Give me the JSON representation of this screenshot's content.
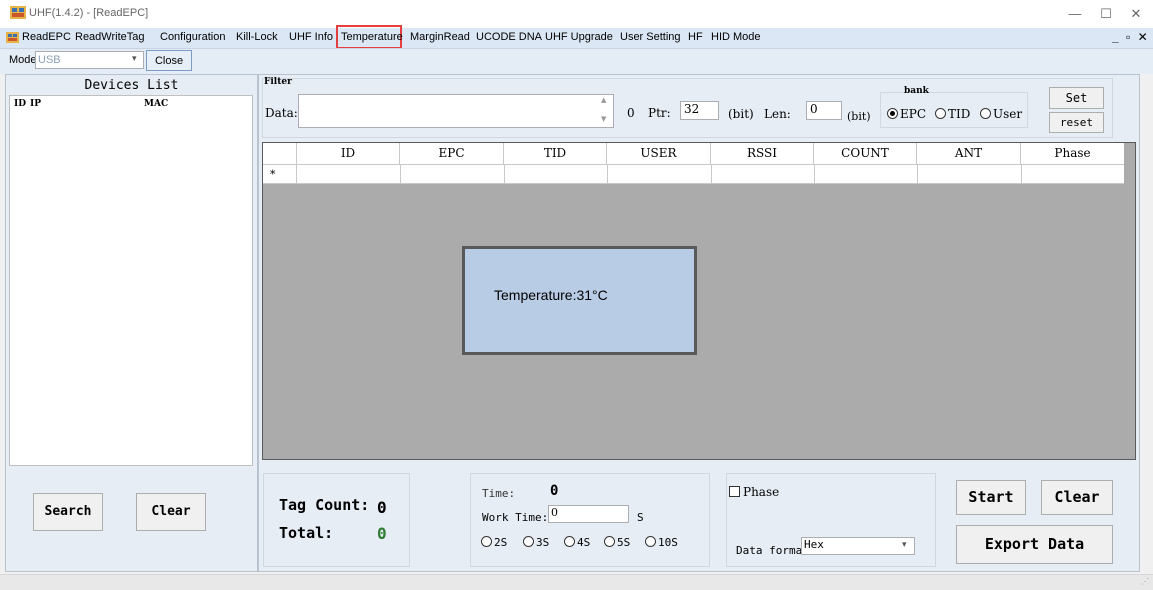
{
  "window": {
    "title": "UHF(1.4.2) - [ReadEPC]",
    "min_glyph": "—",
    "max_glyph": "☐",
    "close_glyph": "✕",
    "mdi_controls": "_ ▫ ✕"
  },
  "menu": [
    "ReadEPC",
    "ReadWriteTag",
    "Configuration",
    "Kill-Lock",
    "UHF Info",
    "Temperature",
    "MarginRead",
    "UCODE DNA",
    "UHF Upgrade",
    "User Setting",
    "HF",
    "HID Mode"
  ],
  "toolbar": {
    "mode_label": "Mode",
    "mode_value": "USB",
    "close_label": "Close"
  },
  "devices": {
    "title": "Devices List",
    "columns": [
      "ID",
      "IP",
      "MAC"
    ],
    "search_label": "Search",
    "clear_label": "Clear"
  },
  "filter": {
    "title": "Filter",
    "data_label": "Data:",
    "data_value": "",
    "count": "0",
    "ptr_label": "Ptr:",
    "ptr_value": "32",
    "bit1": "(bit)",
    "len_label": "Len:",
    "len_value": "0",
    "bit2": "(bit)",
    "bank_label": "bank",
    "bank_options": [
      "EPC",
      "TID",
      "User"
    ],
    "bank_selected": "EPC",
    "set_label": "Set",
    "reset_label": "reset"
  },
  "table": {
    "columns": [
      "ID",
      "EPC",
      "TID",
      "USER",
      "RSSI",
      "COUNT",
      "ANT",
      "Phase"
    ],
    "new_row_marker": "*"
  },
  "popup": {
    "text": "Temperature:31°C"
  },
  "stats": {
    "tag_count_label": "Tag Count:",
    "tag_count_value": "0",
    "total_label": "Total:",
    "total_value": "0"
  },
  "timing": {
    "time_label": "Time:",
    "time_value": "0",
    "work_time_label": "Work Time:",
    "work_time_value": "0",
    "unit": "S",
    "options": [
      "2S",
      "3S",
      "4S",
      "5S",
      "10S"
    ]
  },
  "options": {
    "phase_label": "Phase",
    "phase_checked": false,
    "data_format_label": "Data forma",
    "data_format_value": "Hex"
  },
  "actions": {
    "start_label": "Start",
    "clear_label": "Clear",
    "export_label": "Export Data"
  },
  "colors": {
    "highlight": "#e53e3e",
    "total_value": "#2e7d32",
    "popup_bg": "#b8cce6"
  }
}
